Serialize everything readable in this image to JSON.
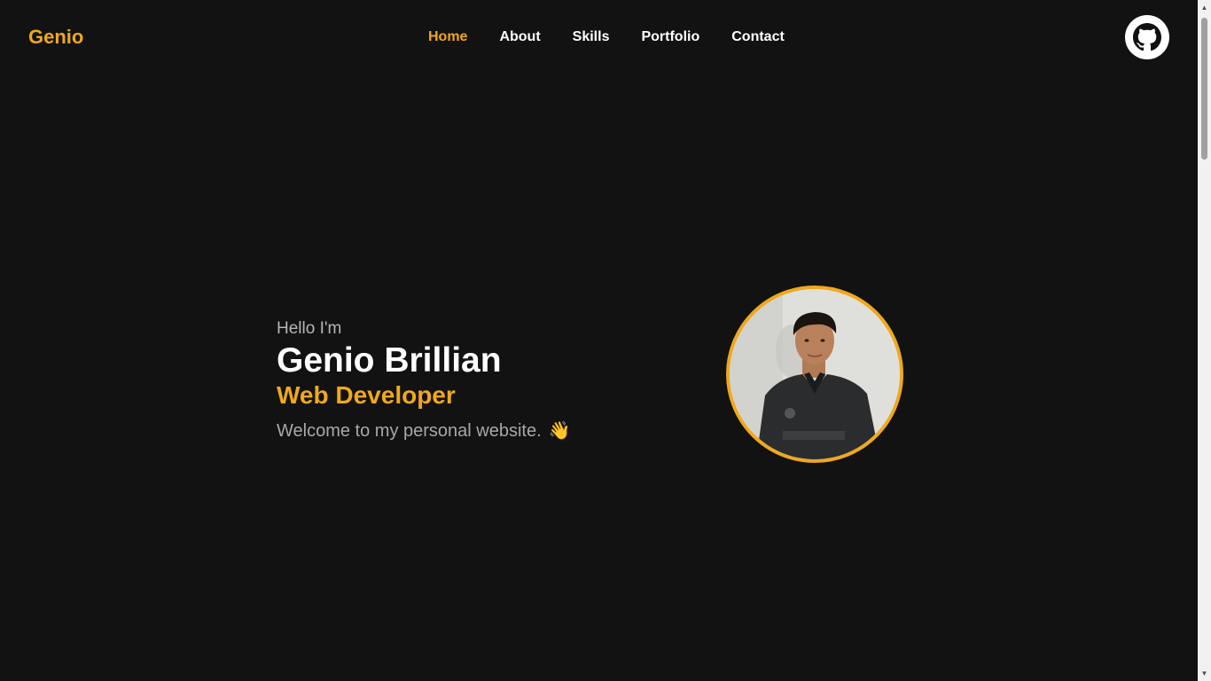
{
  "header": {
    "logo": "Genio",
    "nav": [
      {
        "label": "Home",
        "active": true
      },
      {
        "label": "About",
        "active": false
      },
      {
        "label": "Skills",
        "active": false
      },
      {
        "label": "Portfolio",
        "active": false
      },
      {
        "label": "Contact",
        "active": false
      }
    ],
    "github_icon": "github-icon"
  },
  "hero": {
    "greeting": "Hello I'm",
    "name": "Genio Brillian",
    "role": "Web Developer",
    "welcome": "Welcome to my personal website.",
    "wave_emoji": "👋"
  },
  "colors": {
    "background": "#121212",
    "accent": "#f0a81c",
    "text": "#ffffff",
    "muted": "#a8a8a8"
  }
}
